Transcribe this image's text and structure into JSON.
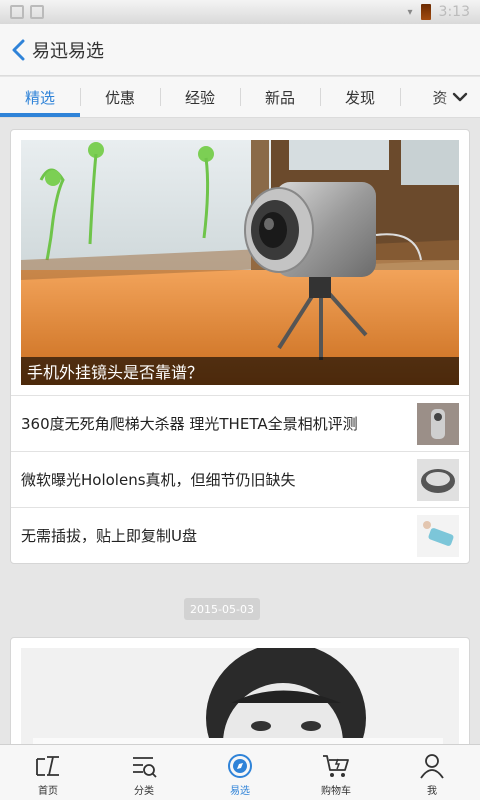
{
  "status_bar": {
    "time": "3:13"
  },
  "header": {
    "title": "易迅易选"
  },
  "tabs": [
    {
      "label": "精选",
      "active": true
    },
    {
      "label": "优惠",
      "active": false
    },
    {
      "label": "经验",
      "active": false
    },
    {
      "label": "新品",
      "active": false
    },
    {
      "label": "发现",
      "active": false
    },
    {
      "label": "资",
      "active": false
    }
  ],
  "feed": {
    "card1": {
      "hero_caption": "手机外挂镜头是否靠谱？",
      "items": [
        {
          "title": "360度无死角爬梯大杀器 理光THETA全景相机评测"
        },
        {
          "title": "微软曝光Hololens真机，但细节仍旧缺失"
        },
        {
          "title": "无需插拔，贴上即复制U盘"
        }
      ]
    },
    "date": "2015-05-03"
  },
  "bottom_nav": [
    {
      "label": "首页",
      "icon": "home-icon",
      "active": false
    },
    {
      "label": "分类",
      "icon": "category-search-icon",
      "active": false
    },
    {
      "label": "易选",
      "icon": "compass-icon",
      "active": true
    },
    {
      "label": "购物车",
      "icon": "cart-icon",
      "active": false
    },
    {
      "label": "我",
      "icon": "user-icon",
      "active": false
    }
  ],
  "colors": {
    "accent": "#2f83d8",
    "background": "#e6e6e6"
  }
}
